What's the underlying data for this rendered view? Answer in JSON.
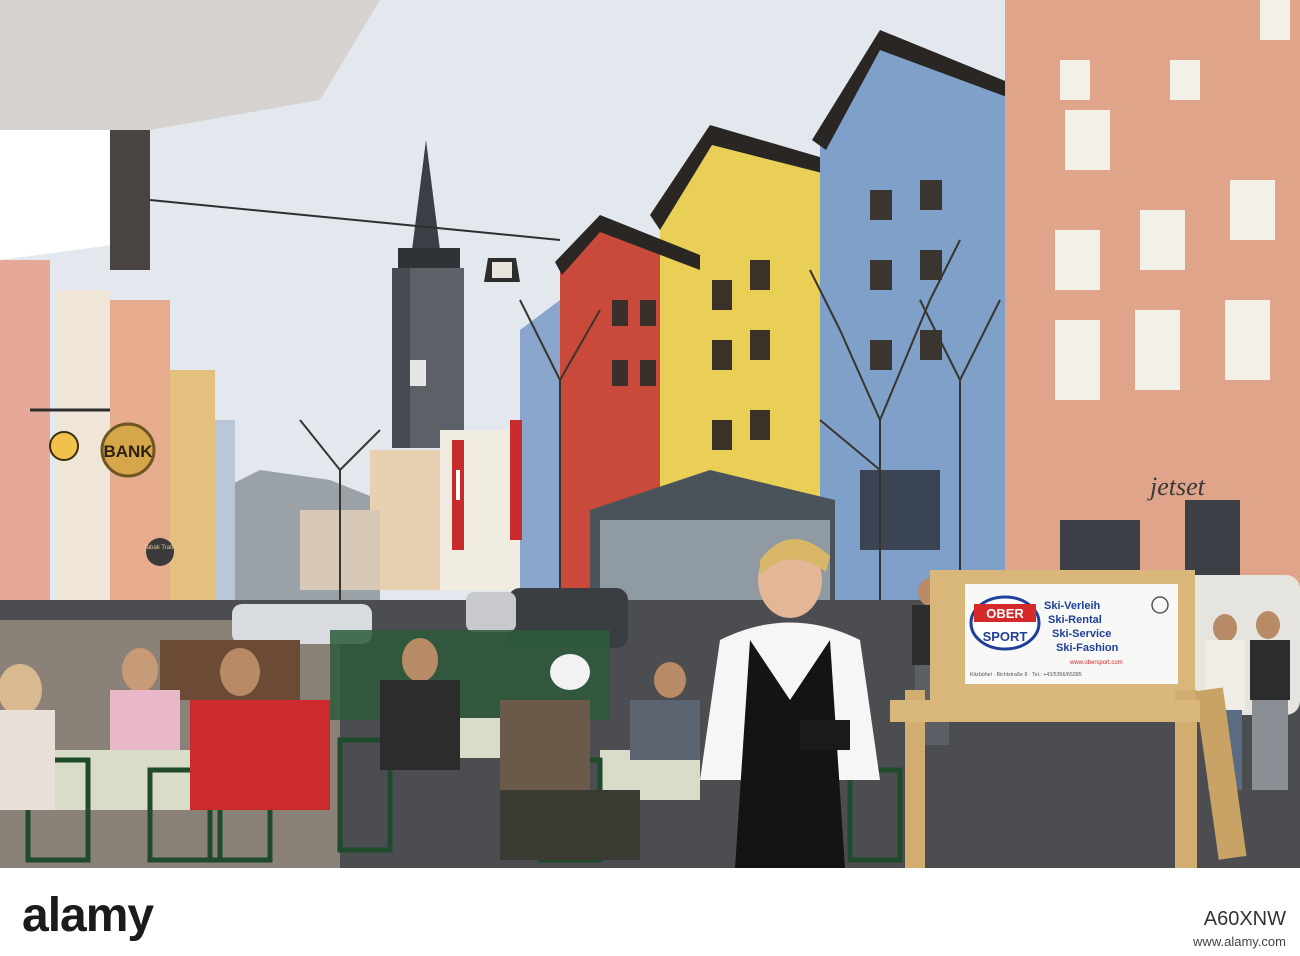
{
  "scene": {
    "bank_sign": "BANK",
    "shop_sign": "Tabak Trafik",
    "store_script": "jetset",
    "ad_board": {
      "logo_top": "OBER",
      "logo_bottom": "SPORT",
      "lines": [
        "Ski-Verleih",
        "Ski-Rental",
        "Ski-Service",
        "Ski-Fashion"
      ],
      "url": "www.obersport.com",
      "address": "Kitzbühel · Bichlstraße 8 · Tel.: +43/5356/65385"
    }
  },
  "watermark": {
    "brand": "alamy",
    "image_id": "A60XNW",
    "url": "www.alamy.com"
  },
  "colors": {
    "sky": "#dfe4ec",
    "salmon_facade": "#e0a58c",
    "blue_facade": "#7fa0c8",
    "yellow_facade": "#e8cf5a",
    "red_facade": "#c8453a",
    "ad_red": "#d42a2a",
    "ad_blue": "#1f3f9a"
  }
}
